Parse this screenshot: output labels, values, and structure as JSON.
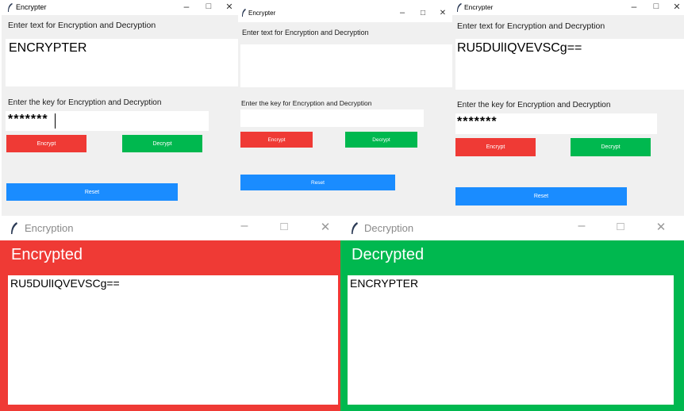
{
  "colors": {
    "encrypt": "#ef3a35",
    "decrypt": "#00b84f",
    "reset": "#1a8cff",
    "window_bg": "#f0f0f0"
  },
  "icons": {
    "app": "feather-icon",
    "minimize": "minimize-icon",
    "maximize": "maximize-icon",
    "close": "close-icon"
  },
  "windows": {
    "w1": {
      "title": "Encrypter",
      "text_label": "Enter text for Encryption and Decryption",
      "text_value": "ENCRYPTER",
      "key_label": "Enter the key for Encryption and Decryption",
      "key_value": "*******",
      "encrypt": "Encrypt",
      "decrypt": "Decrypt",
      "reset": "Reset"
    },
    "w2": {
      "title": "Encrypter",
      "text_label": "Enter text for Encryption and Decryption",
      "text_value": "",
      "key_label": "Enter the key for Encryption and Decryption",
      "key_value": "",
      "encrypt": "Encrypt",
      "decrypt": "Decrypt",
      "reset": "Reset"
    },
    "w3": {
      "title": "Encrypter",
      "text_label": "Enter text for Encryption and Decryption",
      "text_value": "RU5DUlIQVEVSCg==",
      "key_label": "Enter the key for Encryption and Decryption",
      "key_value": "*******",
      "encrypt": "Encrypt",
      "decrypt": "Decrypt",
      "reset": "Reset"
    },
    "encryption": {
      "title": "Encryption",
      "heading": "Encrypted",
      "result": "RU5DUlIQVEVSCg=="
    },
    "decryption": {
      "title": "Decryption",
      "heading": "Decrypted",
      "result": "ENCRYPTER"
    }
  }
}
